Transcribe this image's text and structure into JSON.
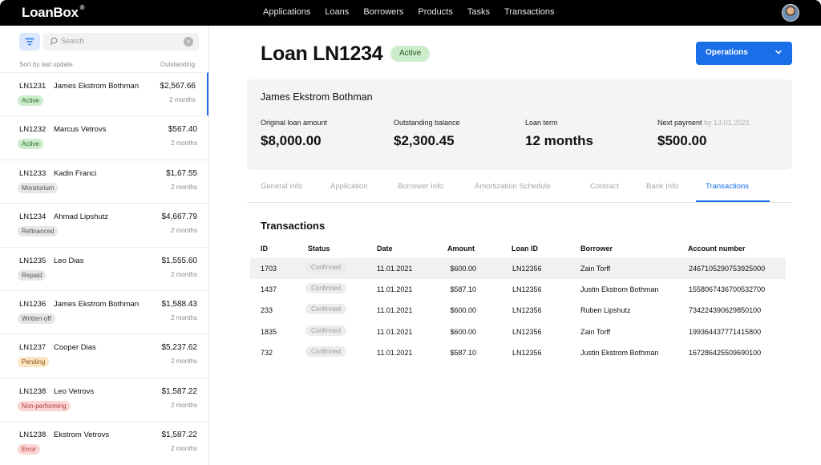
{
  "app": {
    "logo": "LoanBox",
    "logo_mark": "®"
  },
  "nav": [
    "Applications",
    "Loans",
    "Borrowers",
    "Products",
    "Tasks",
    "Transactions"
  ],
  "sidebar": {
    "search_placeholder": "Search",
    "sort_label": "Sort by last update",
    "outstanding_label": "Outstanding",
    "loans": [
      {
        "id": "LN1231",
        "name": "James Ekstrom Bothman",
        "amount": "$2,567.66",
        "status": "Active",
        "time": "2 months"
      },
      {
        "id": "LN1232",
        "name": "Marcus Vetrovs",
        "amount": "$567.40",
        "status": "Active",
        "time": "2 months"
      },
      {
        "id": "LN1233",
        "name": "Kadin Franci",
        "amount": "$1,67.55",
        "status": "Moratorium",
        "time": "2 months"
      },
      {
        "id": "LN1234",
        "name": "Ahmad Lipshutz",
        "amount": "$4,667.79",
        "status": "Refinanced",
        "time": "2 months"
      },
      {
        "id": "LN1235",
        "name": "Leo Dias",
        "amount": "$1,555.60",
        "status": "Repaid",
        "time": "2 months"
      },
      {
        "id": "LN1236",
        "name": "James Ekstrom Bothman",
        "amount": "$1,588.43",
        "status": "Written-off",
        "time": "2 months"
      },
      {
        "id": "LN1237",
        "name": "Cooper Dias",
        "amount": "$5,237.62",
        "status": "Pending",
        "time": "2 months"
      },
      {
        "id": "LN1238",
        "name": "Leo Vetrovs",
        "amount": "$1,587.22",
        "status": "Non-performing",
        "time": "2 months"
      },
      {
        "id": "LN1238",
        "name": "Ekstrom Vetrovs",
        "amount": "$1,587.22",
        "status": "Error",
        "time": "2 months"
      }
    ]
  },
  "status_colors": {
    "Active": {
      "bg": "#cdeccb",
      "fg": "#2b6a2b"
    },
    "Moratorium": {
      "bg": "#e6e6e6",
      "fg": "#555555"
    },
    "Refinanced": {
      "bg": "#e6e6e6",
      "fg": "#555555"
    },
    "Repaid": {
      "bg": "#e6e6e6",
      "fg": "#555555"
    },
    "Written-off": {
      "bg": "#e6e6e6",
      "fg": "#555555"
    },
    "Pending": {
      "bg": "#fbe5c2",
      "fg": "#8a5a12"
    },
    "Non-performing": {
      "bg": "#fbd4d4",
      "fg": "#b23a3a"
    },
    "Error": {
      "bg": "#fbd4d4",
      "fg": "#b23a3a"
    }
  },
  "loan": {
    "title": "Loan LN1234",
    "status": "Active",
    "operations_label": "Operations",
    "borrower": "James Ekstrom Bothman",
    "metrics": [
      {
        "label": "Original loan amount",
        "sub": "",
        "value": "$8,000.00"
      },
      {
        "label": "Outstanding balance",
        "sub": "",
        "value": "$2,300.45"
      },
      {
        "label": "Loan term",
        "sub": "",
        "value": "12 months"
      },
      {
        "label": "Next payment",
        "sub": "by 13.01.2021",
        "value": "$500.00"
      }
    ]
  },
  "tabs": [
    {
      "label": "General Info",
      "active": false
    },
    {
      "label": "Application",
      "active": false
    },
    {
      "label": "Borrower Info",
      "active": false
    },
    {
      "label": "Amortization Schedule",
      "active": false
    },
    {
      "label": "Contract",
      "active": false
    },
    {
      "label": "Bank Info",
      "active": false
    },
    {
      "label": "Transactions",
      "active": true
    }
  ],
  "transactions": {
    "title": "Transactions",
    "columns": [
      "ID",
      "Status",
      "Date",
      "Amount",
      "Loan ID",
      "Borrower",
      "Account number"
    ],
    "rows": [
      {
        "id": "1703",
        "status": "Confirmed",
        "date": "11.01.2021",
        "amount": "$600.00",
        "loan_id": "LN12356",
        "borrower": "Zain Torff",
        "account": "2467105290753925000"
      },
      {
        "id": "1437",
        "status": "Confirmed",
        "date": "11.01.2021",
        "amount": "$587.10",
        "loan_id": "LN12356",
        "borrower": "Justin Ekstrom Bothman",
        "account": "1558067436700532700"
      },
      {
        "id": "233",
        "status": "Confirmed",
        "date": "11.01.2021",
        "amount": "$600.00",
        "loan_id": "LN12356",
        "borrower": "Ruben Lipshutz",
        "account": "734224390629850100"
      },
      {
        "id": "1835",
        "status": "Confirmed",
        "date": "11.01.2021",
        "amount": "$600.00",
        "loan_id": "LN12356",
        "borrower": "Zain Torff",
        "account": "199364437771415800"
      },
      {
        "id": "732",
        "status": "Confirmed",
        "date": "11.01.2021",
        "amount": "$587.10",
        "loan_id": "LN12356",
        "borrower": "Justin Ekstrom Bothman",
        "account": "167286425509690100"
      }
    ]
  }
}
